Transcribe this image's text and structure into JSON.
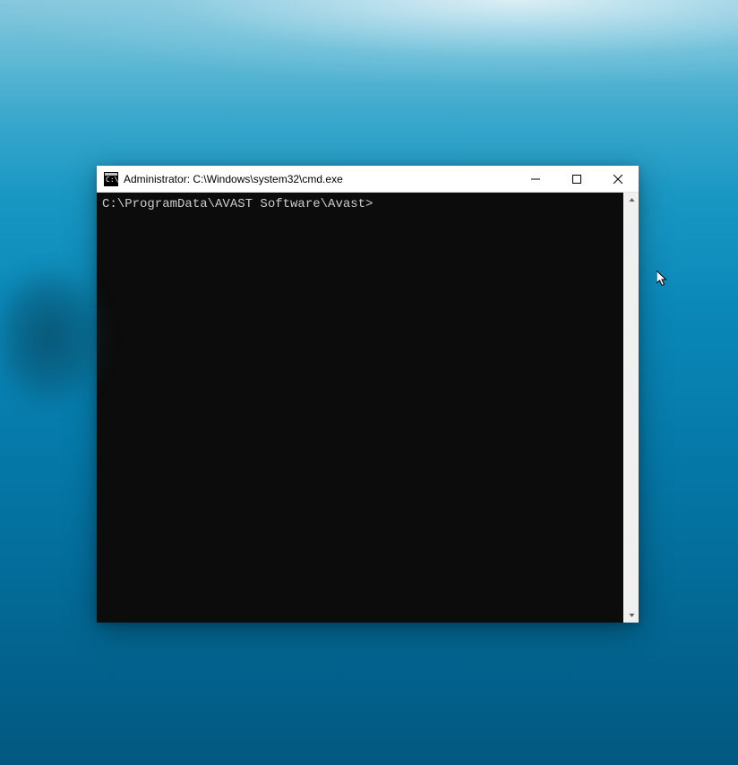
{
  "window": {
    "title": "Administrator: C:\\Windows\\system32\\cmd.exe",
    "icon_name": "cmd-icon"
  },
  "terminal": {
    "prompt": "C:\\ProgramData\\AVAST Software\\Avast>"
  }
}
